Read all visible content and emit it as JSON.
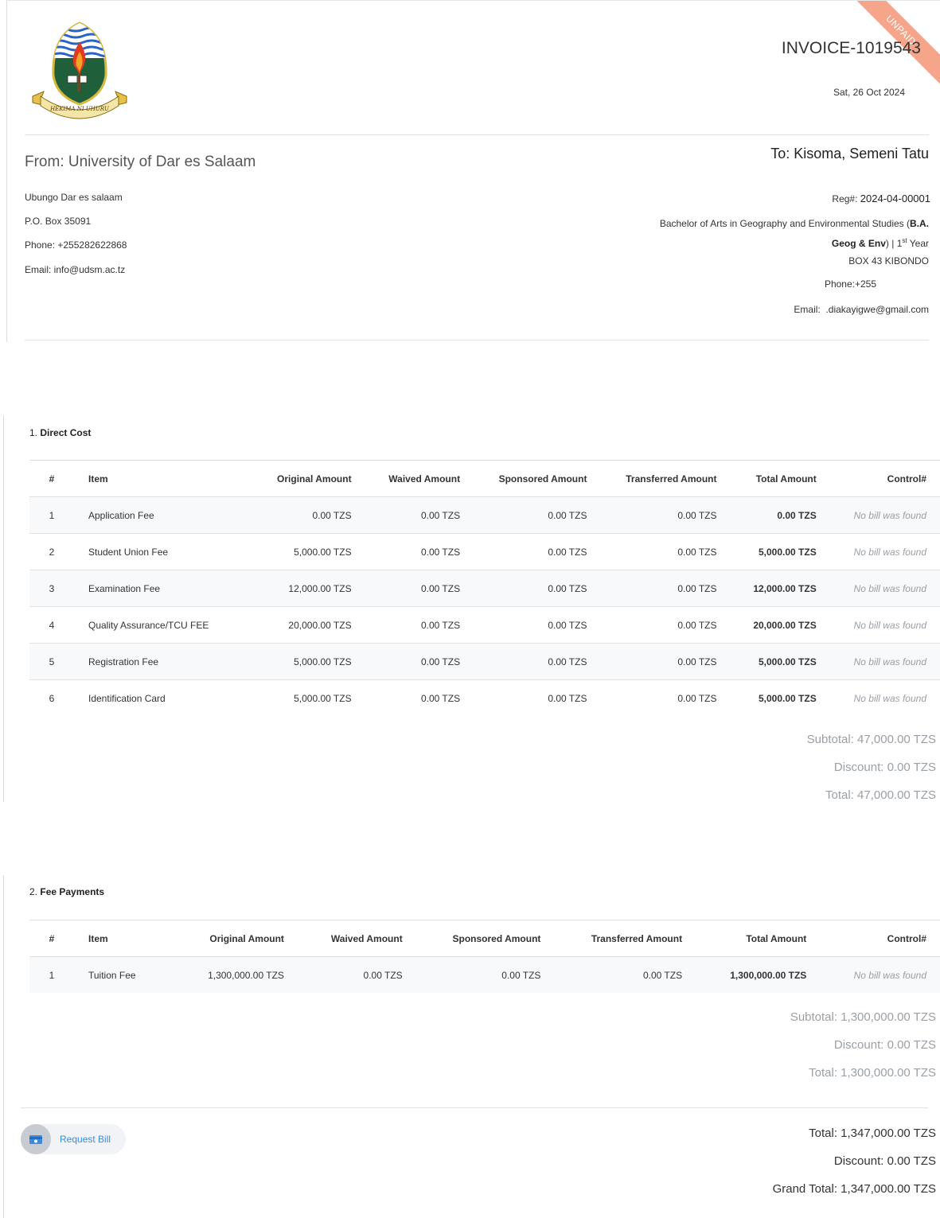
{
  "invoice": {
    "status": "UNPAID",
    "number": "INVOICE-1019543",
    "date": "Sat, 26 Oct 2024",
    "logo_motto": "HEKIMA NI UHURU"
  },
  "from": {
    "title": "From: University of Dar es Salaam",
    "address": "Ubungo Dar es salaam",
    "pobox": "P.O. Box 35091",
    "phone": "Phone: +255282622868",
    "email": "Email: info@udsm.ac.tz"
  },
  "to": {
    "title": "To: Kisoma, Semeni Tatu",
    "reg_label": "Reg#:",
    "reg_value": "2024-04-00001",
    "programme_prefix": "Bachelor of Arts in Geography and Environmental Studies (",
    "programme_code_line1": "B.A.",
    "programme_code_line2": "Geog & Env",
    "programme_suffix": ") | 1",
    "year_sup": "st",
    "year_word": "Year",
    "box": "BOX 43 KIBONDO",
    "phone": "Phone:+255",
    "email_label": "Email:",
    "email_value": ".diakayigwe@gmail.com"
  },
  "columns": {
    "num": "#",
    "item": "Item",
    "original": "Original Amount",
    "waived": "Waived Amount",
    "sponsored": "Sponsored Amount",
    "transferred": "Transferred Amount",
    "total": "Total Amount",
    "control": "Control#"
  },
  "direct_cost": {
    "number": "1.",
    "title": "Direct Cost",
    "rows": [
      {
        "num": "1",
        "item": "Application Fee",
        "original": "0.00 TZS",
        "waived": "0.00 TZS",
        "sponsored": "0.00 TZS",
        "transferred": "0.00 TZS",
        "total": "0.00 TZS",
        "control": "No bill was found"
      },
      {
        "num": "2",
        "item": "Student Union Fee",
        "original": "5,000.00 TZS",
        "waived": "0.00 TZS",
        "sponsored": "0.00 TZS",
        "transferred": "0.00 TZS",
        "total": "5,000.00 TZS",
        "control": "No bill was found"
      },
      {
        "num": "3",
        "item": "Examination Fee",
        "original": "12,000.00 TZS",
        "waived": "0.00 TZS",
        "sponsored": "0.00 TZS",
        "transferred": "0.00 TZS",
        "total": "12,000.00 TZS",
        "control": "No bill was found"
      },
      {
        "num": "4",
        "item": "Quality Assurance/TCU FEE",
        "original": "20,000.00 TZS",
        "waived": "0.00 TZS",
        "sponsored": "0.00 TZS",
        "transferred": "0.00 TZS",
        "total": "20,000.00 TZS",
        "control": "No bill was found"
      },
      {
        "num": "5",
        "item": "Registration Fee",
        "original": "5,000.00 TZS",
        "waived": "0.00 TZS",
        "sponsored": "0.00 TZS",
        "transferred": "0.00 TZS",
        "total": "5,000.00 TZS",
        "control": "No bill was found"
      },
      {
        "num": "6",
        "item": "Identification Card",
        "original": "5,000.00 TZS",
        "waived": "0.00 TZS",
        "sponsored": "0.00 TZS",
        "transferred": "0.00 TZS",
        "total": "5,000.00 TZS",
        "control": "No bill was found"
      }
    ],
    "subtotal": "Subtotal: 47,000.00 TZS",
    "discount": "Discount: 0.00 TZS",
    "total": "Total: 47,000.00 TZS"
  },
  "fee_payments": {
    "number": "2.",
    "title": "Fee Payments",
    "rows": [
      {
        "num": "1",
        "item": "Tuition Fee",
        "original": "1,300,000.00 TZS",
        "waived": "0.00 TZS",
        "sponsored": "0.00 TZS",
        "transferred": "0.00 TZS",
        "total": "1,300,000.00 TZS",
        "control": "No bill was found"
      }
    ],
    "subtotal": "Subtotal: 1,300,000.00 TZS",
    "discount": "Discount: 0.00 TZS",
    "total": "Total: 1,300,000.00 TZS"
  },
  "grand": {
    "total": "Total: 1,347,000.00 TZS",
    "discount": "Discount: 0.00 TZS",
    "grand_total": "Grand Total: 1,347,000.00 TZS"
  },
  "request_bill": {
    "label": "Request Bill",
    "icon": "bill-icon",
    "accent": "#3a8be0"
  }
}
